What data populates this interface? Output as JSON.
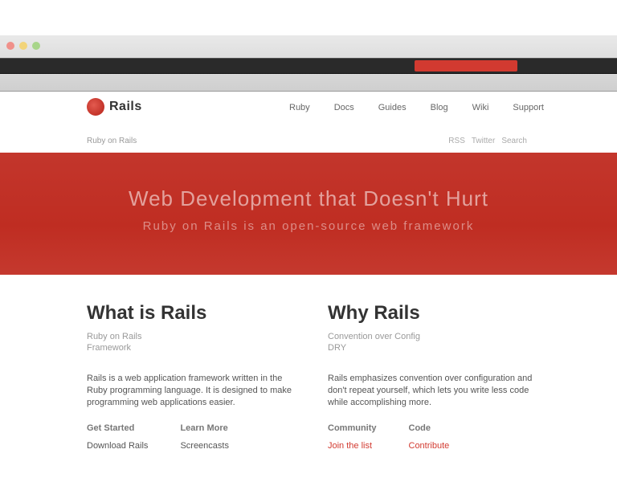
{
  "browser": {
    "bookmark_accent": "#d23a30"
  },
  "site": {
    "logo_text": "Rails",
    "nav": [
      "Ruby",
      "Docs",
      "Guides",
      "Blog",
      "Wiki",
      "Support"
    ],
    "sub_left": "Ruby on Rails",
    "sub_right": [
      "RSS",
      "Twitter",
      "Search"
    ]
  },
  "hero": {
    "title": "Web Development that Doesn't Hurt",
    "subtitle": "Ruby on Rails is an open-source web framework"
  },
  "columns": [
    {
      "title": "What is Rails",
      "meta": [
        "Ruby on Rails",
        "Framework"
      ],
      "body": "Rails is a web application framework written in the Ruby programming language. It is designed to make programming web applications easier.",
      "links": [
        {
          "title": "Get Started",
          "link": "Download Rails",
          "red": false
        },
        {
          "title": "Learn More",
          "link": "Screencasts",
          "red": false
        }
      ]
    },
    {
      "title": "Why Rails",
      "meta": [
        "Convention over Config",
        "DRY"
      ],
      "body": "Rails emphasizes convention over configuration and don't repeat yourself, which lets you write less code while accomplishing more.",
      "links": [
        {
          "title": "Community",
          "link": "Join the list",
          "red": true
        },
        {
          "title": "Code",
          "link": "Contribute",
          "red": true
        }
      ]
    }
  ],
  "colors": {
    "hero_red": "#c3362c",
    "accent_red": "#d23a30"
  }
}
